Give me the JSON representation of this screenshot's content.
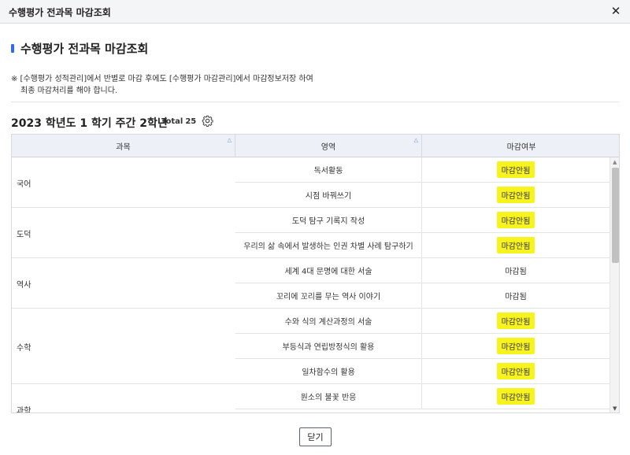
{
  "window": {
    "title": "수행평가 전과목 마감조회",
    "close_icon": "✕"
  },
  "page": {
    "heading": "수행평가 전과목 마감조회",
    "notice_line1": "※ [수행평가 성적관리]에서 반별로 마감 후에도 [수행평가 마감관리]에서 마감정보저장 하여",
    "notice_line2": "최종 마감처리를 해야 합니다."
  },
  "section": {
    "title": "2023 학년도 1 학기 주간 2학년",
    "total_label": "Total",
    "total_count": "25",
    "settings_icon": "gear-icon"
  },
  "table": {
    "columns": [
      {
        "label": "과목",
        "sortable": true
      },
      {
        "label": "영역",
        "sortable": true
      },
      {
        "label": "마감여부",
        "sortable": false
      }
    ],
    "subjects": [
      {
        "name": "국어"
      },
      {
        "name": "도덕"
      },
      {
        "name": "역사"
      },
      {
        "name": "수학"
      },
      {
        "name": "과학"
      }
    ],
    "rows": [
      {
        "area": "독서활동",
        "status": "마감안됨",
        "highlight": true
      },
      {
        "area": "시점 바꿔쓰기",
        "status": "마감안됨",
        "highlight": true
      },
      {
        "area": "도덕 탐구 기록지 작성",
        "status": "마감안됨",
        "highlight": true
      },
      {
        "area": "우리의 삶 속에서 발생하는 인권 차별 사례 탐구하기",
        "status": "마감안됨",
        "highlight": true
      },
      {
        "area": "세계 4대 문명에 대한 서술",
        "status": "마감됨",
        "highlight": false
      },
      {
        "area": "꼬리에 꼬리를 무는 역사 이야기",
        "status": "마감됨",
        "highlight": false
      },
      {
        "area": "수와 식의 계산과정의 서술",
        "status": "마감안됨",
        "highlight": true
      },
      {
        "area": "부등식과 연립방정식의 활용",
        "status": "마감안됨",
        "highlight": true
      },
      {
        "area": "일차함수의 활용",
        "status": "마감안됨",
        "highlight": true
      },
      {
        "area": "원소의 불꽃 반응",
        "status": "마감안됨",
        "highlight": true
      }
    ],
    "highlight_color": "#f7f31e"
  },
  "footer": {
    "close_label": "닫기"
  },
  "colors": {
    "accent": "#2f6fe4",
    "header_bg": "#edf1f7"
  }
}
